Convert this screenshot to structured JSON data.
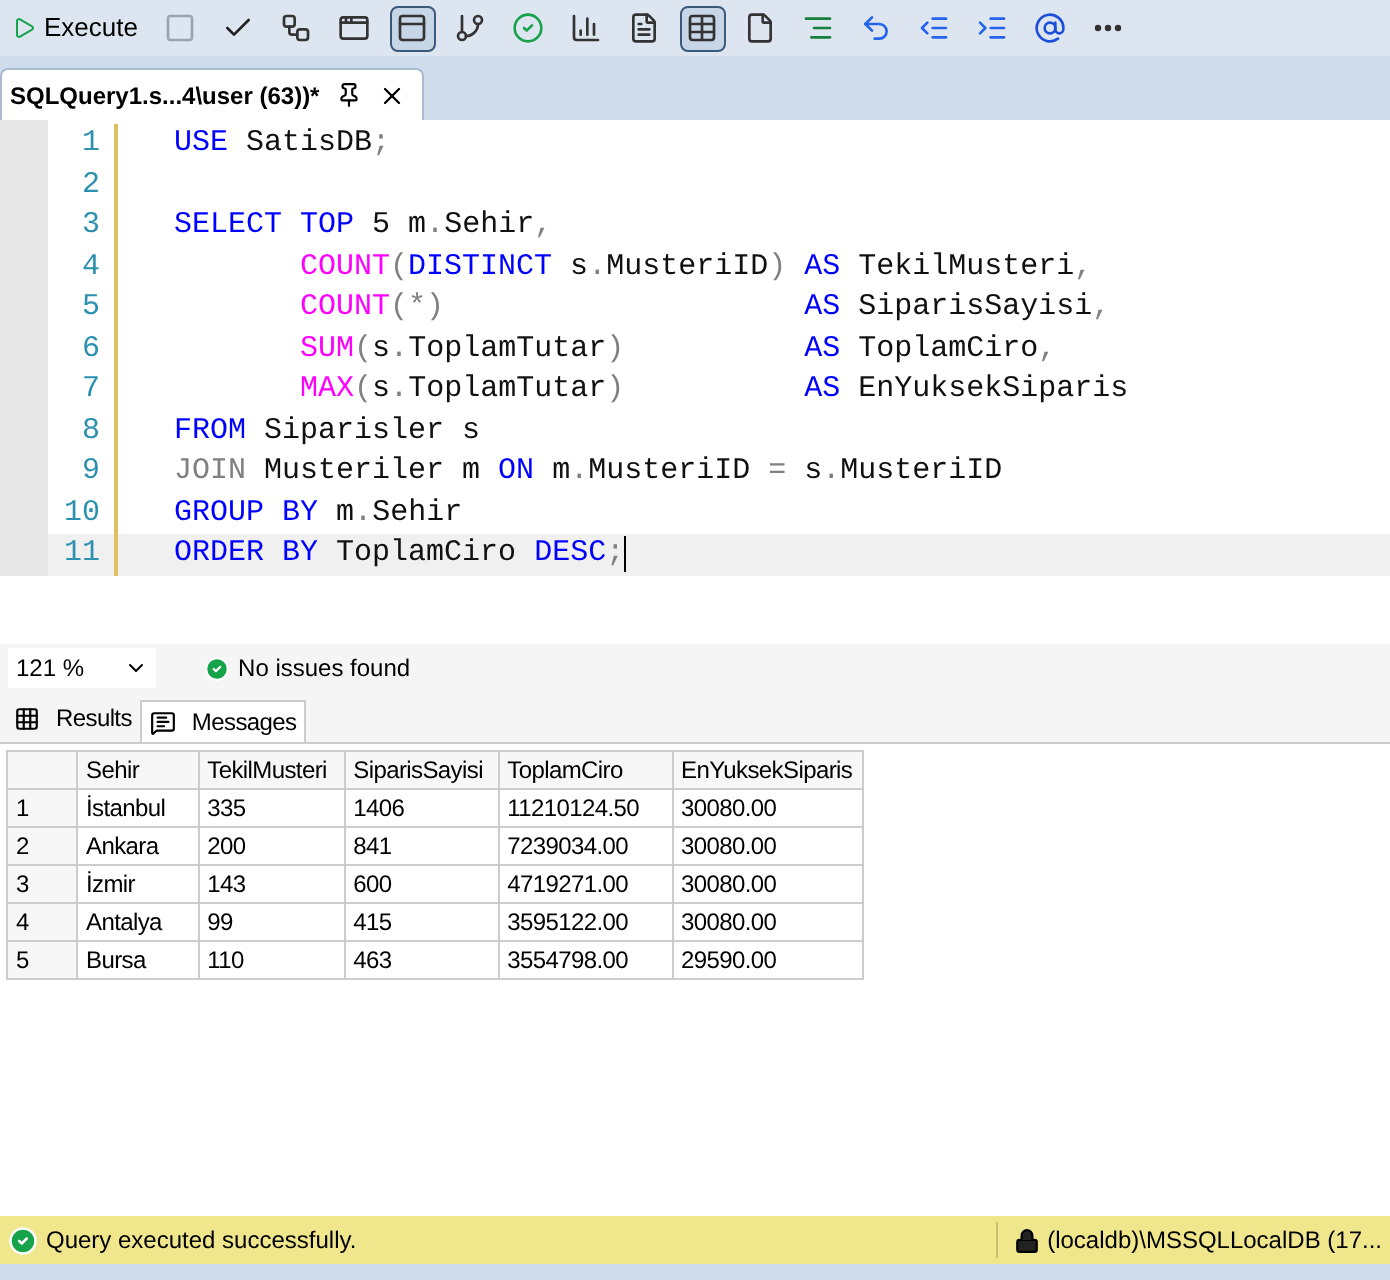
{
  "toolbar": {
    "execute_label": "Execute",
    "buttons": [
      {
        "kind": "stop",
        "selected": false
      },
      {
        "kind": "check",
        "selected": false
      },
      {
        "kind": "plan",
        "selected": false
      },
      {
        "kind": "text",
        "selected": false
      },
      {
        "kind": "form",
        "selected": true
      },
      {
        "kind": "flow",
        "selected": false
      },
      {
        "kind": "flowok",
        "selected": false
      },
      {
        "kind": "stats",
        "selected": false
      },
      {
        "kind": "file",
        "selected": false
      },
      {
        "kind": "grid",
        "selected": true
      },
      {
        "kind": "doc",
        "selected": false
      },
      {
        "kind": "comment",
        "selected": false
      },
      {
        "kind": "uncomment",
        "selected": false
      },
      {
        "kind": "outdent",
        "selected": false
      },
      {
        "kind": "indent",
        "selected": false
      },
      {
        "kind": "param",
        "selected": false
      },
      {
        "kind": "more",
        "selected": false
      }
    ]
  },
  "document_tab": {
    "title": "SQLQuery1.s...4\\user (63))*"
  },
  "editor": {
    "lines": [
      {
        "number": "1",
        "current": false,
        "indented": false,
        "tokens": [
          {
            "text": "USE ",
            "kind": "keyword"
          },
          {
            "text": "SatisDB",
            "kind": "name"
          },
          {
            "text": ";",
            "kind": "punct"
          }
        ]
      },
      {
        "number": "2",
        "current": false,
        "indented": false
      },
      {
        "number": "3",
        "current": false,
        "indented": false,
        "tokens": [
          {
            "text": "SELECT ",
            "kind": "keyword"
          },
          {
            "text": "TOP ",
            "kind": "keyword"
          },
          {
            "text": "5 m",
            "kind": "name"
          },
          {
            "text": ".",
            "kind": "punct"
          },
          {
            "text": "Sehir",
            "kind": "name"
          },
          {
            "text": ",",
            "kind": "punct"
          }
        ]
      },
      {
        "number": "4",
        "current": false,
        "indented": true,
        "tokens": [
          {
            "text": "COUNT",
            "kind": "function"
          },
          {
            "text": "(",
            "kind": "punct"
          },
          {
            "text": "DISTINCT ",
            "kind": "keyword"
          },
          {
            "text": "s",
            "kind": "name"
          },
          {
            "text": ".",
            "kind": "punct"
          },
          {
            "text": "MusteriID",
            "kind": "name"
          },
          {
            "text": ") ",
            "kind": "punct"
          },
          {
            "text": "AS ",
            "kind": "keyword"
          },
          {
            "text": "TekilMusteri",
            "kind": "name"
          },
          {
            "text": ",",
            "kind": "punct"
          }
        ]
      },
      {
        "number": "5",
        "current": false,
        "indented": true,
        "tokens": [
          {
            "text": "COUNT",
            "kind": "function"
          },
          {
            "text": "(*)                    ",
            "kind": "punct"
          },
          {
            "text": "AS ",
            "kind": "keyword"
          },
          {
            "text": "SiparisSayisi",
            "kind": "name"
          },
          {
            "text": ",",
            "kind": "punct"
          }
        ]
      },
      {
        "number": "6",
        "current": false,
        "indented": true,
        "tokens": [
          {
            "text": "SUM",
            "kind": "function"
          },
          {
            "text": "(",
            "kind": "punct"
          },
          {
            "text": "s",
            "kind": "name"
          },
          {
            "text": ".",
            "kind": "punct"
          },
          {
            "text": "ToplamTutar",
            "kind": "name"
          },
          {
            "text": ")          ",
            "kind": "punct"
          },
          {
            "text": "AS ",
            "kind": "keyword"
          },
          {
            "text": "ToplamCiro",
            "kind": "name"
          },
          {
            "text": ",",
            "kind": "punct"
          }
        ]
      },
      {
        "number": "7",
        "current": false,
        "indented": true,
        "tokens": [
          {
            "text": "MAX",
            "kind": "function"
          },
          {
            "text": "(",
            "kind": "punct"
          },
          {
            "text": "s",
            "kind": "name"
          },
          {
            "text": ".",
            "kind": "punct"
          },
          {
            "text": "ToplamTutar",
            "kind": "name"
          },
          {
            "text": ")          ",
            "kind": "punct"
          },
          {
            "text": "AS ",
            "kind": "keyword"
          },
          {
            "text": "EnYuksekSiparis",
            "kind": "name"
          }
        ]
      },
      {
        "number": "8",
        "current": false,
        "indented": false,
        "tokens": [
          {
            "text": "FROM ",
            "kind": "keyword"
          },
          {
            "text": "Siparisler s",
            "kind": "name"
          }
        ]
      },
      {
        "number": "9",
        "current": false,
        "indented": false,
        "tokens": [
          {
            "text": "JOIN ",
            "kind": "punct"
          },
          {
            "text": "Musteriler m ",
            "kind": "name"
          },
          {
            "text": "ON ",
            "kind": "keyword"
          },
          {
            "text": "m",
            "kind": "name"
          },
          {
            "text": ".",
            "kind": "punct"
          },
          {
            "text": "MusteriID ",
            "kind": "name"
          },
          {
            "text": "= ",
            "kind": "punct"
          },
          {
            "text": "s",
            "kind": "name"
          },
          {
            "text": ".",
            "kind": "punct"
          },
          {
            "text": "MusteriID",
            "kind": "name"
          }
        ]
      },
      {
        "number": "10",
        "current": false,
        "indented": false,
        "tokens": [
          {
            "text": "GROUP ",
            "kind": "keyword"
          },
          {
            "text": "BY ",
            "kind": "keyword"
          },
          {
            "text": "m",
            "kind": "name"
          },
          {
            "text": ".",
            "kind": "punct"
          },
          {
            "text": "Sehir",
            "kind": "name"
          }
        ]
      },
      {
        "number": "11",
        "current": true,
        "indented": false,
        "tokens": [
          {
            "text": "ORDER ",
            "kind": "keyword"
          },
          {
            "text": "BY ",
            "kind": "keyword"
          },
          {
            "text": "ToplamCiro ",
            "kind": "name"
          },
          {
            "text": "DESC",
            "kind": "keyword"
          },
          {
            "text": ";",
            "kind": "punct"
          }
        ]
      }
    ]
  },
  "zoom": "121 %",
  "issues": "No issues found",
  "result_tabs": [
    {
      "label": "Results",
      "kind": "grid",
      "selected": true
    },
    {
      "label": "Messages",
      "kind": "messages",
      "selected": false
    }
  ],
  "table": {
    "columns": [
      "Sehir",
      "TekilMusteri",
      "SiparisSayisi",
      "ToplamCiro",
      "EnYuksekSiparis"
    ],
    "rows": [
      {
        "number": "1",
        "cells": [
          "İstanbul",
          "335",
          "1406",
          "11210124.50",
          "30080.00"
        ]
      },
      {
        "number": "2",
        "cells": [
          "Ankara",
          "200",
          "841",
          "7239034.00",
          "30080.00"
        ]
      },
      {
        "number": "3",
        "cells": [
          "İzmir",
          "143",
          "600",
          "4719271.00",
          "30080.00"
        ]
      },
      {
        "number": "4",
        "cells": [
          "Antalya",
          "99",
          "415",
          "3595122.00",
          "30080.00"
        ]
      },
      {
        "number": "5",
        "cells": [
          "Bursa",
          "110",
          "463",
          "3554798.00",
          "29590.00"
        ]
      }
    ]
  },
  "status_bar": {
    "message": "Query executed successfully.",
    "connection": "(localdb)\\MSSQLLocalDB (17..."
  }
}
